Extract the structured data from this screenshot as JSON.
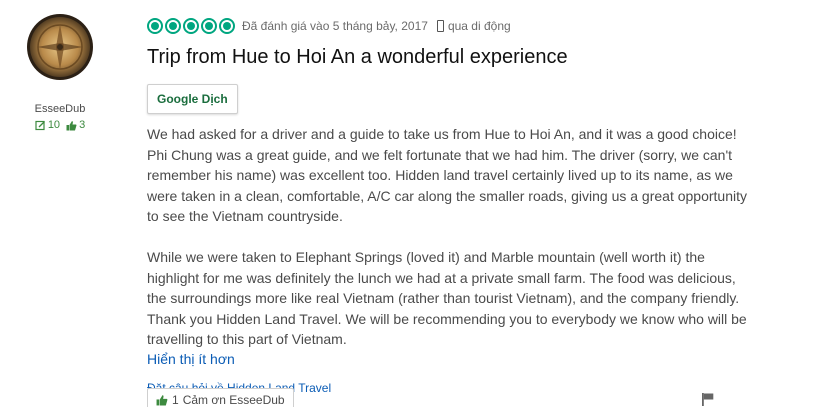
{
  "user": {
    "name": "EsseeDub",
    "reviews_count": "10",
    "helpful_votes": "3"
  },
  "review": {
    "rating": 5,
    "max_rating": 5,
    "review_date": "Đã đánh giá vào 5 tháng bảy, 2017",
    "device_label": "qua di động",
    "title": "Trip from Hue to Hoi An a wonderful experience",
    "translate_label": "Google Dịch",
    "paragraphs": [
      "We had asked for a driver and a guide to take us from Hue to Hoi An, and it was a good choice! Phi Chung was a great guide, and we felt fortunate that we had him. The driver (sorry, we can't remember his name) was excellent too. Hidden land travel certainly lived up to its name, as we were taken in a clean, comfortable, A/C car along the smaller roads, giving us a great opportunity to see the Vietnam countryside.",
      "While we were taken to Elephant Springs (loved it) and Marble mountain (well worth it) the highlight for me was definitely the lunch we had at a private small farm. The food was delicious, the surroundings more like real Vietnam (rather than tourist Vietnam), and the company friendly. Thank you Hidden Land Travel. We will be recommending you to everybody we know who will be travelling to this part of Vietnam."
    ],
    "show_less_label": "Hiển thị ít hơn",
    "ask_question_label": "Đặt câu hỏi về Hidden Land Travel",
    "thanks_count": "1",
    "thanks_label": "Cảm ơn EsseeDub"
  },
  "colors": {
    "bubble": "#00a680",
    "link": "#0b5cb5",
    "stats_green": "#3d8a3f"
  },
  "icons": [
    "review-count-icon",
    "helpful-votes-icon",
    "mobile-phone-icon",
    "thumbs-up-icon",
    "flag-icon"
  ]
}
